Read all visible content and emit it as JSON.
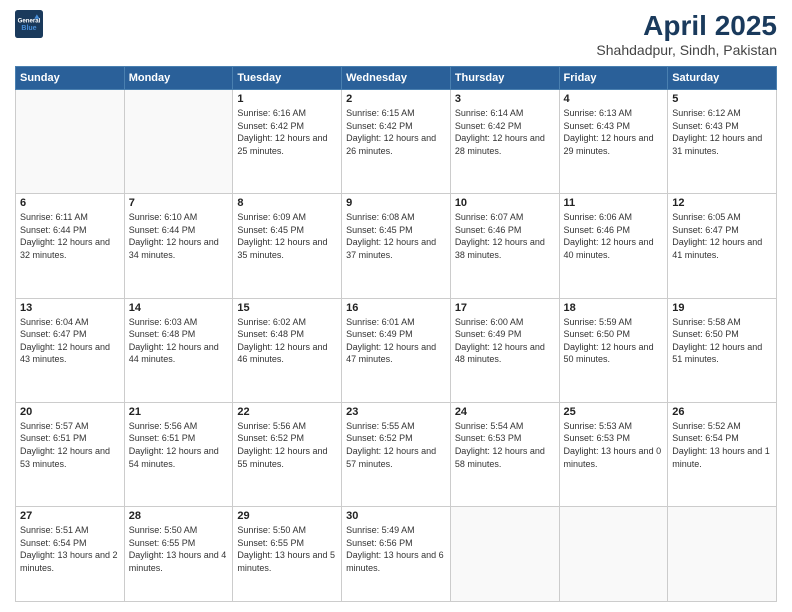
{
  "header": {
    "logo_line1": "General",
    "logo_line2": "Blue",
    "title": "April 2025",
    "subtitle": "Shahdadpur, Sindh, Pakistan"
  },
  "weekdays": [
    "Sunday",
    "Monday",
    "Tuesday",
    "Wednesday",
    "Thursday",
    "Friday",
    "Saturday"
  ],
  "weeks": [
    [
      {
        "day": "",
        "info": ""
      },
      {
        "day": "",
        "info": ""
      },
      {
        "day": "1",
        "info": "Sunrise: 6:16 AM\nSunset: 6:42 PM\nDaylight: 12 hours and 25 minutes."
      },
      {
        "day": "2",
        "info": "Sunrise: 6:15 AM\nSunset: 6:42 PM\nDaylight: 12 hours and 26 minutes."
      },
      {
        "day": "3",
        "info": "Sunrise: 6:14 AM\nSunset: 6:42 PM\nDaylight: 12 hours and 28 minutes."
      },
      {
        "day": "4",
        "info": "Sunrise: 6:13 AM\nSunset: 6:43 PM\nDaylight: 12 hours and 29 minutes."
      },
      {
        "day": "5",
        "info": "Sunrise: 6:12 AM\nSunset: 6:43 PM\nDaylight: 12 hours and 31 minutes."
      }
    ],
    [
      {
        "day": "6",
        "info": "Sunrise: 6:11 AM\nSunset: 6:44 PM\nDaylight: 12 hours and 32 minutes."
      },
      {
        "day": "7",
        "info": "Sunrise: 6:10 AM\nSunset: 6:44 PM\nDaylight: 12 hours and 34 minutes."
      },
      {
        "day": "8",
        "info": "Sunrise: 6:09 AM\nSunset: 6:45 PM\nDaylight: 12 hours and 35 minutes."
      },
      {
        "day": "9",
        "info": "Sunrise: 6:08 AM\nSunset: 6:45 PM\nDaylight: 12 hours and 37 minutes."
      },
      {
        "day": "10",
        "info": "Sunrise: 6:07 AM\nSunset: 6:46 PM\nDaylight: 12 hours and 38 minutes."
      },
      {
        "day": "11",
        "info": "Sunrise: 6:06 AM\nSunset: 6:46 PM\nDaylight: 12 hours and 40 minutes."
      },
      {
        "day": "12",
        "info": "Sunrise: 6:05 AM\nSunset: 6:47 PM\nDaylight: 12 hours and 41 minutes."
      }
    ],
    [
      {
        "day": "13",
        "info": "Sunrise: 6:04 AM\nSunset: 6:47 PM\nDaylight: 12 hours and 43 minutes."
      },
      {
        "day": "14",
        "info": "Sunrise: 6:03 AM\nSunset: 6:48 PM\nDaylight: 12 hours and 44 minutes."
      },
      {
        "day": "15",
        "info": "Sunrise: 6:02 AM\nSunset: 6:48 PM\nDaylight: 12 hours and 46 minutes."
      },
      {
        "day": "16",
        "info": "Sunrise: 6:01 AM\nSunset: 6:49 PM\nDaylight: 12 hours and 47 minutes."
      },
      {
        "day": "17",
        "info": "Sunrise: 6:00 AM\nSunset: 6:49 PM\nDaylight: 12 hours and 48 minutes."
      },
      {
        "day": "18",
        "info": "Sunrise: 5:59 AM\nSunset: 6:50 PM\nDaylight: 12 hours and 50 minutes."
      },
      {
        "day": "19",
        "info": "Sunrise: 5:58 AM\nSunset: 6:50 PM\nDaylight: 12 hours and 51 minutes."
      }
    ],
    [
      {
        "day": "20",
        "info": "Sunrise: 5:57 AM\nSunset: 6:51 PM\nDaylight: 12 hours and 53 minutes."
      },
      {
        "day": "21",
        "info": "Sunrise: 5:56 AM\nSunset: 6:51 PM\nDaylight: 12 hours and 54 minutes."
      },
      {
        "day": "22",
        "info": "Sunrise: 5:56 AM\nSunset: 6:52 PM\nDaylight: 12 hours and 55 minutes."
      },
      {
        "day": "23",
        "info": "Sunrise: 5:55 AM\nSunset: 6:52 PM\nDaylight: 12 hours and 57 minutes."
      },
      {
        "day": "24",
        "info": "Sunrise: 5:54 AM\nSunset: 6:53 PM\nDaylight: 12 hours and 58 minutes."
      },
      {
        "day": "25",
        "info": "Sunrise: 5:53 AM\nSunset: 6:53 PM\nDaylight: 13 hours and 0 minutes."
      },
      {
        "day": "26",
        "info": "Sunrise: 5:52 AM\nSunset: 6:54 PM\nDaylight: 13 hours and 1 minute."
      }
    ],
    [
      {
        "day": "27",
        "info": "Sunrise: 5:51 AM\nSunset: 6:54 PM\nDaylight: 13 hours and 2 minutes."
      },
      {
        "day": "28",
        "info": "Sunrise: 5:50 AM\nSunset: 6:55 PM\nDaylight: 13 hours and 4 minutes."
      },
      {
        "day": "29",
        "info": "Sunrise: 5:50 AM\nSunset: 6:55 PM\nDaylight: 13 hours and 5 minutes."
      },
      {
        "day": "30",
        "info": "Sunrise: 5:49 AM\nSunset: 6:56 PM\nDaylight: 13 hours and 6 minutes."
      },
      {
        "day": "",
        "info": ""
      },
      {
        "day": "",
        "info": ""
      },
      {
        "day": "",
        "info": ""
      }
    ]
  ]
}
